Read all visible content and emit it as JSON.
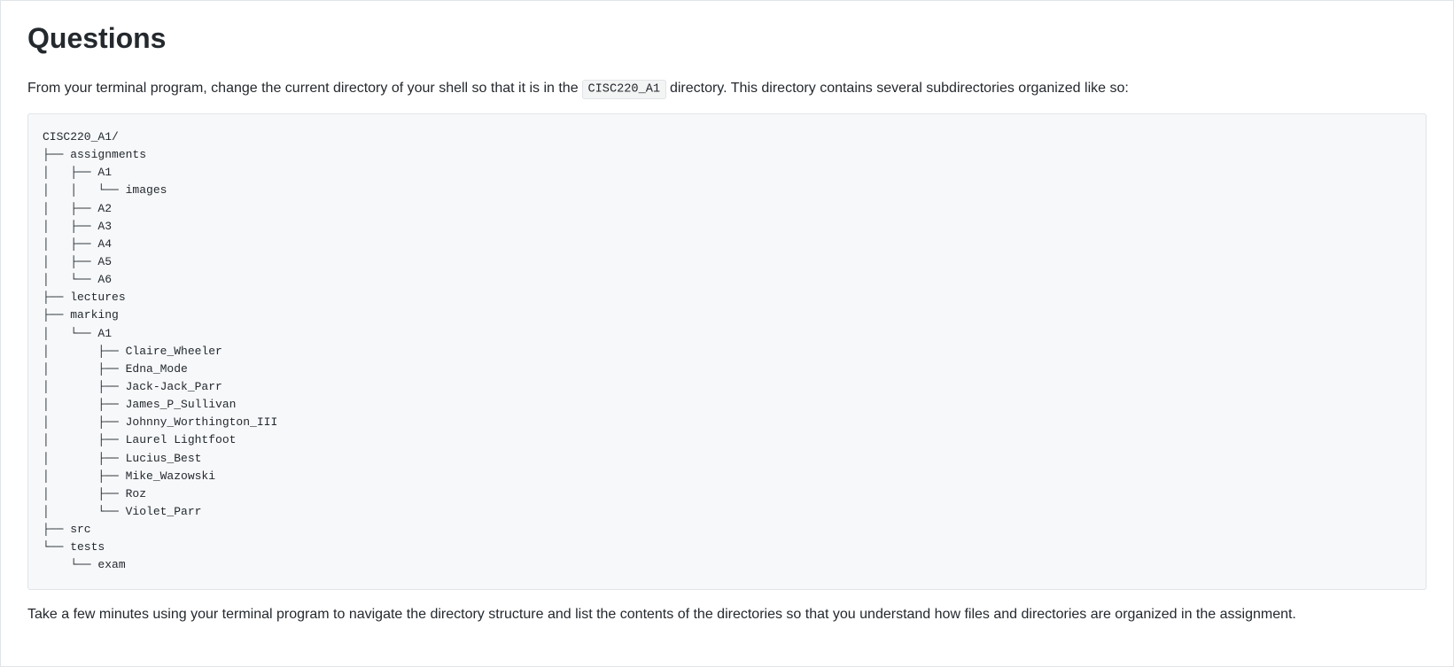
{
  "heading": "Questions",
  "intro_prefix": "From your terminal program, change the current directory of your shell so that it is in the ",
  "intro_code": "CISC220_A1",
  "intro_suffix": " directory. This directory contains several subdirectories organized like so:",
  "tree": "CISC220_A1/\n├── assignments\n│   ├── A1\n│   │   └── images\n│   ├── A2\n│   ├── A3\n│   ├── A4\n│   ├── A5\n│   └── A6\n├── lectures\n├── marking\n│   └── A1\n│       ├── Claire_Wheeler\n│       ├── Edna_Mode\n│       ├── Jack-Jack_Parr\n│       ├── James_P_Sullivan\n│       ├── Johnny_Worthington_III\n│       ├── Laurel Lightfoot\n│       ├── Lucius_Best\n│       ├── Mike_Wazowski\n│       ├── Roz\n│       └── Violet_Parr\n├── src\n└── tests\n    └── exam",
  "outro": "Take a few minutes using your terminal program to navigate the directory structure and list the contents of the directories so that you understand how files and directories are organized in the assignment."
}
